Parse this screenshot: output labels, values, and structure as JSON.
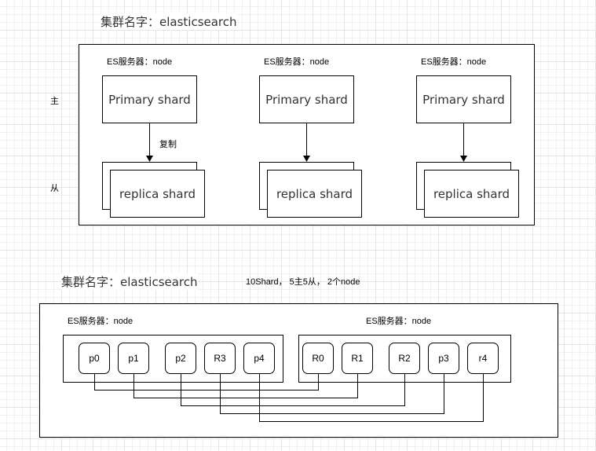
{
  "diagram1": {
    "cluster_title": "集群名字：elasticsearch",
    "row_labels": {
      "primary": "主",
      "replica": "从"
    },
    "copy_label": "复制",
    "nodes": [
      {
        "label": "ES服务器：node",
        "primary": "Primary shard",
        "replica": "replica shard"
      },
      {
        "label": "ES服务器：node",
        "primary": "Primary shard",
        "replica": "replica shard"
      },
      {
        "label": "ES服务器：node",
        "primary": "Primary shard",
        "replica": "replica shard"
      }
    ]
  },
  "diagram2": {
    "cluster_title": "集群名字：elasticsearch",
    "summary": "10Shard， 5主5从， 2个node",
    "nodes": [
      {
        "label": "ES服务器：node",
        "shards": [
          "p0",
          "p1",
          "p2",
          "R3",
          "p4"
        ]
      },
      {
        "label": "ES服务器：node",
        "shards": [
          "R0",
          "R1",
          "R2",
          "p3",
          "r4"
        ]
      }
    ],
    "connections": [
      [
        "p0",
        "R0"
      ],
      [
        "p1",
        "R1"
      ],
      [
        "p2",
        "R2"
      ],
      [
        "R3",
        "p3"
      ],
      [
        "p4",
        "r4"
      ]
    ]
  }
}
